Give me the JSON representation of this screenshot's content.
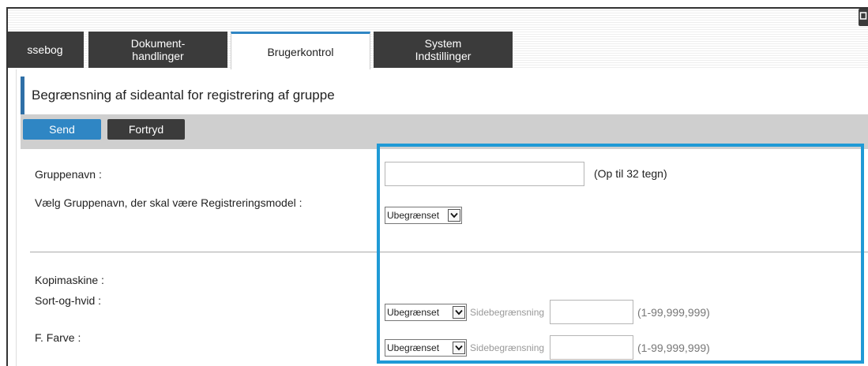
{
  "tabs": [
    {
      "label": "ssebog",
      "active": false
    },
    {
      "label1": "Dokument-",
      "label2": "handlinger",
      "active": false
    },
    {
      "label": "Brugerkontrol",
      "active": true
    },
    {
      "label1": "System",
      "label2": "Indstillinger",
      "active": false
    }
  ],
  "page": {
    "title": "Begrænsning af sideantal for registrering af gruppe"
  },
  "toolbar": {
    "send_label": "Send",
    "undo_label": "Fortryd"
  },
  "form": {
    "group_name_label": "Gruppenavn :",
    "group_name_value": "",
    "group_name_hint": "(Op til 32 tegn)",
    "model_label": "Vælg Gruppenavn, der skal være Registreringsmodel :",
    "model_value": "Ubegrænset",
    "copier_label": "Kopimaskine :",
    "bw_label": "Sort-og-hvid :",
    "bw_value": "Ubegrænset",
    "bw_limit_label": "Sidebegrænsning",
    "bw_limit_value": "",
    "bw_range": "(1-99,999,999)",
    "color_label": "F. Farve :",
    "color_value": "Ubegrænset",
    "color_limit_label": "Sidebegrænsning",
    "color_limit_value": "",
    "color_range": "(1-99,999,999)"
  },
  "colors": {
    "accent": "#2f86c4",
    "highlight": "#1f9ad6",
    "dark": "#3b3b3b"
  },
  "icons": {
    "corner": "window-icon",
    "caret": "chevron-down-icon"
  }
}
